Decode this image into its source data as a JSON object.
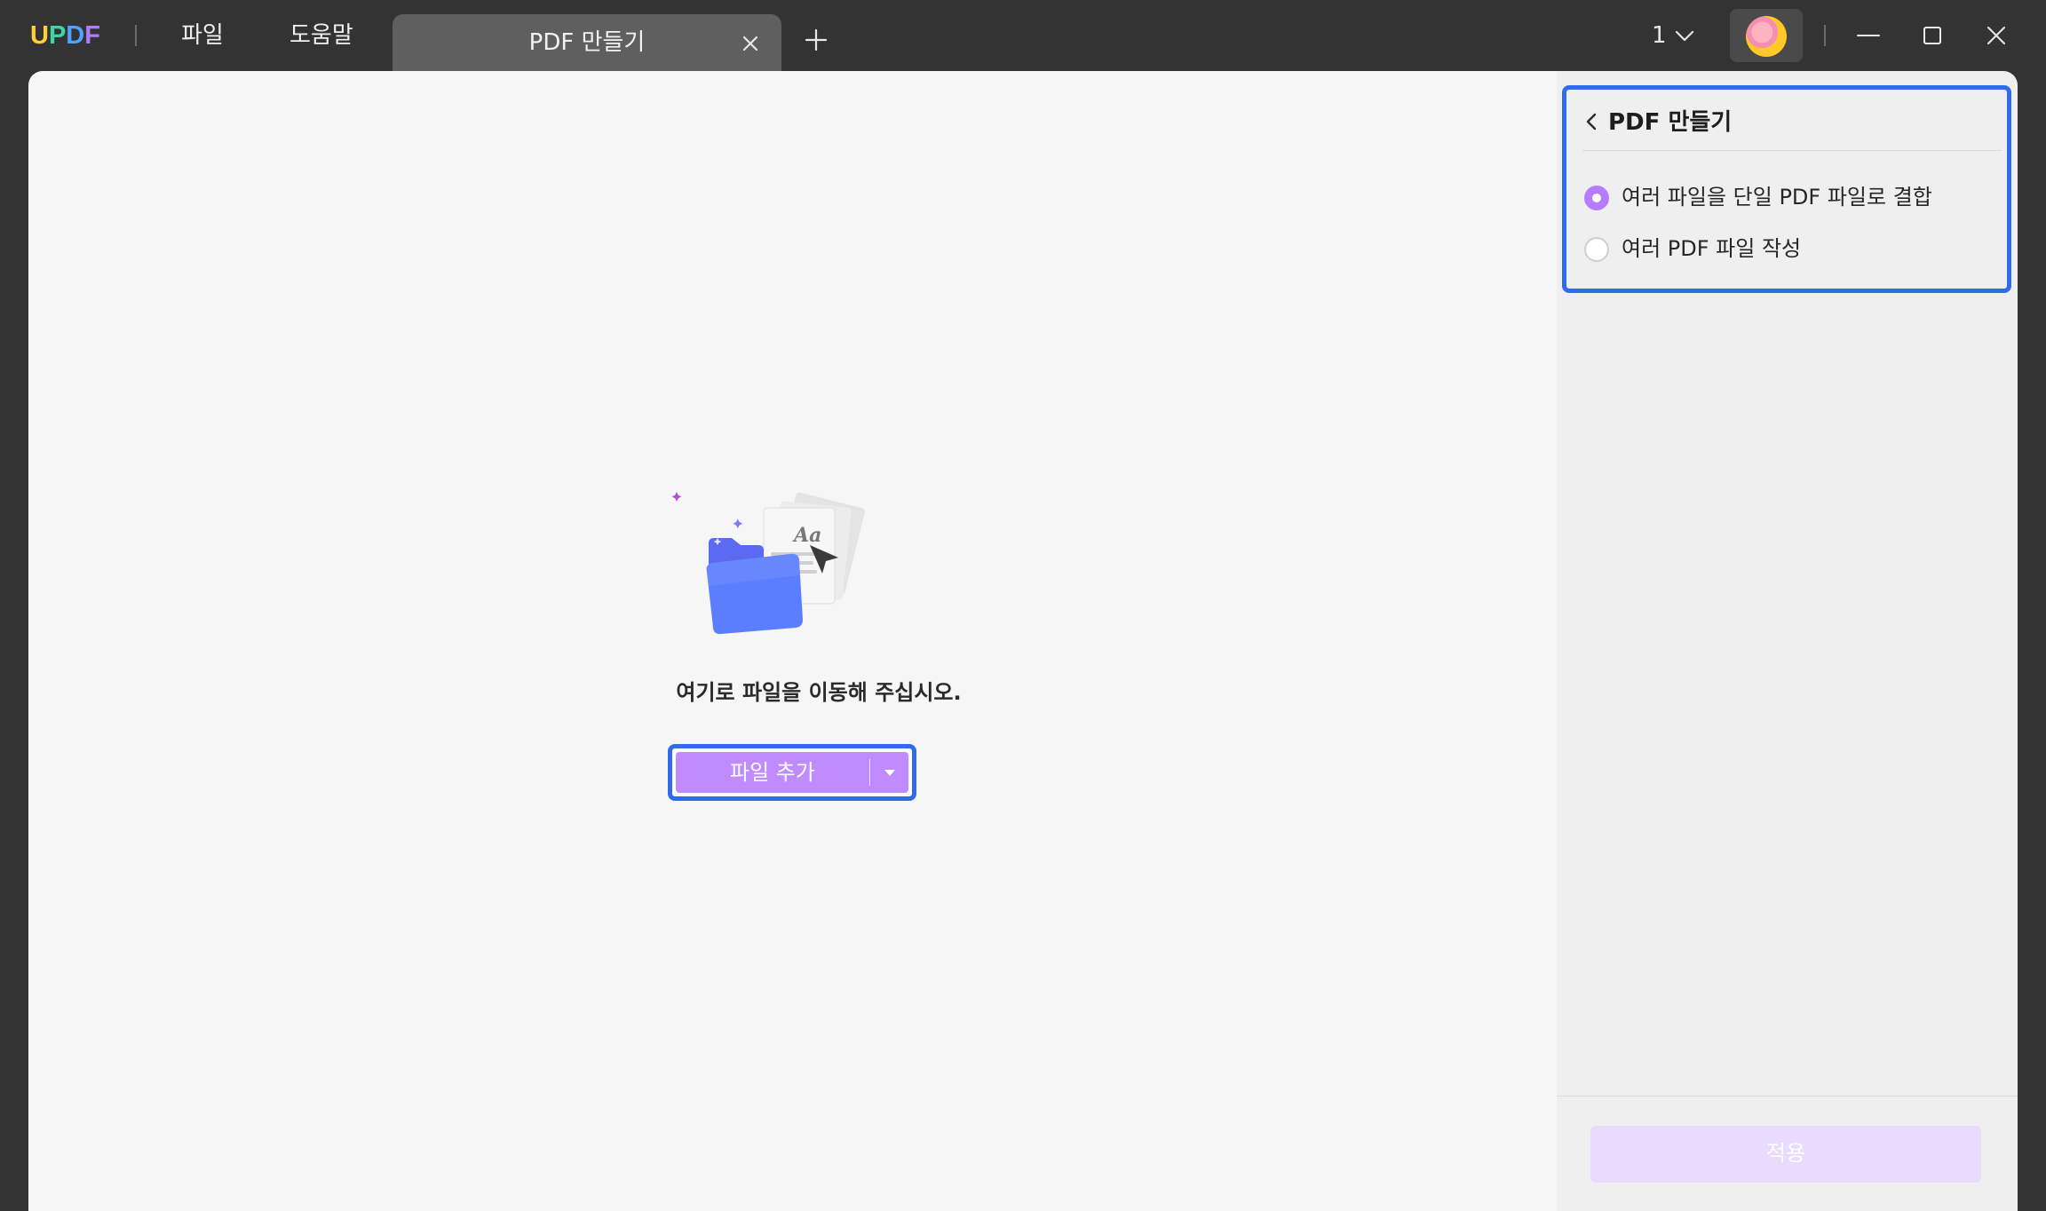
{
  "app": {
    "logo_letters": [
      "U",
      "P",
      "D",
      "F"
    ],
    "menu": {
      "file": "파일",
      "help": "도움말"
    },
    "tab": {
      "title": "PDF 만들기"
    },
    "page_indicator": "1"
  },
  "drop_zone": {
    "message": "여기로 파일을 이동해 주십시오.",
    "add_button_label": "파일 추가"
  },
  "panel": {
    "title": "PDF 만들기",
    "options": [
      {
        "label": "여러 파일을 단일 PDF 파일로 결합",
        "selected": true
      },
      {
        "label": "여러 PDF 파일 작성",
        "selected": false
      }
    ],
    "apply_label": "적용"
  },
  "colors": {
    "accent": "#bf8bff",
    "highlight_border": "#2f6bec",
    "titlebar": "#333333",
    "apply_disabled": "#e9dbfd"
  }
}
